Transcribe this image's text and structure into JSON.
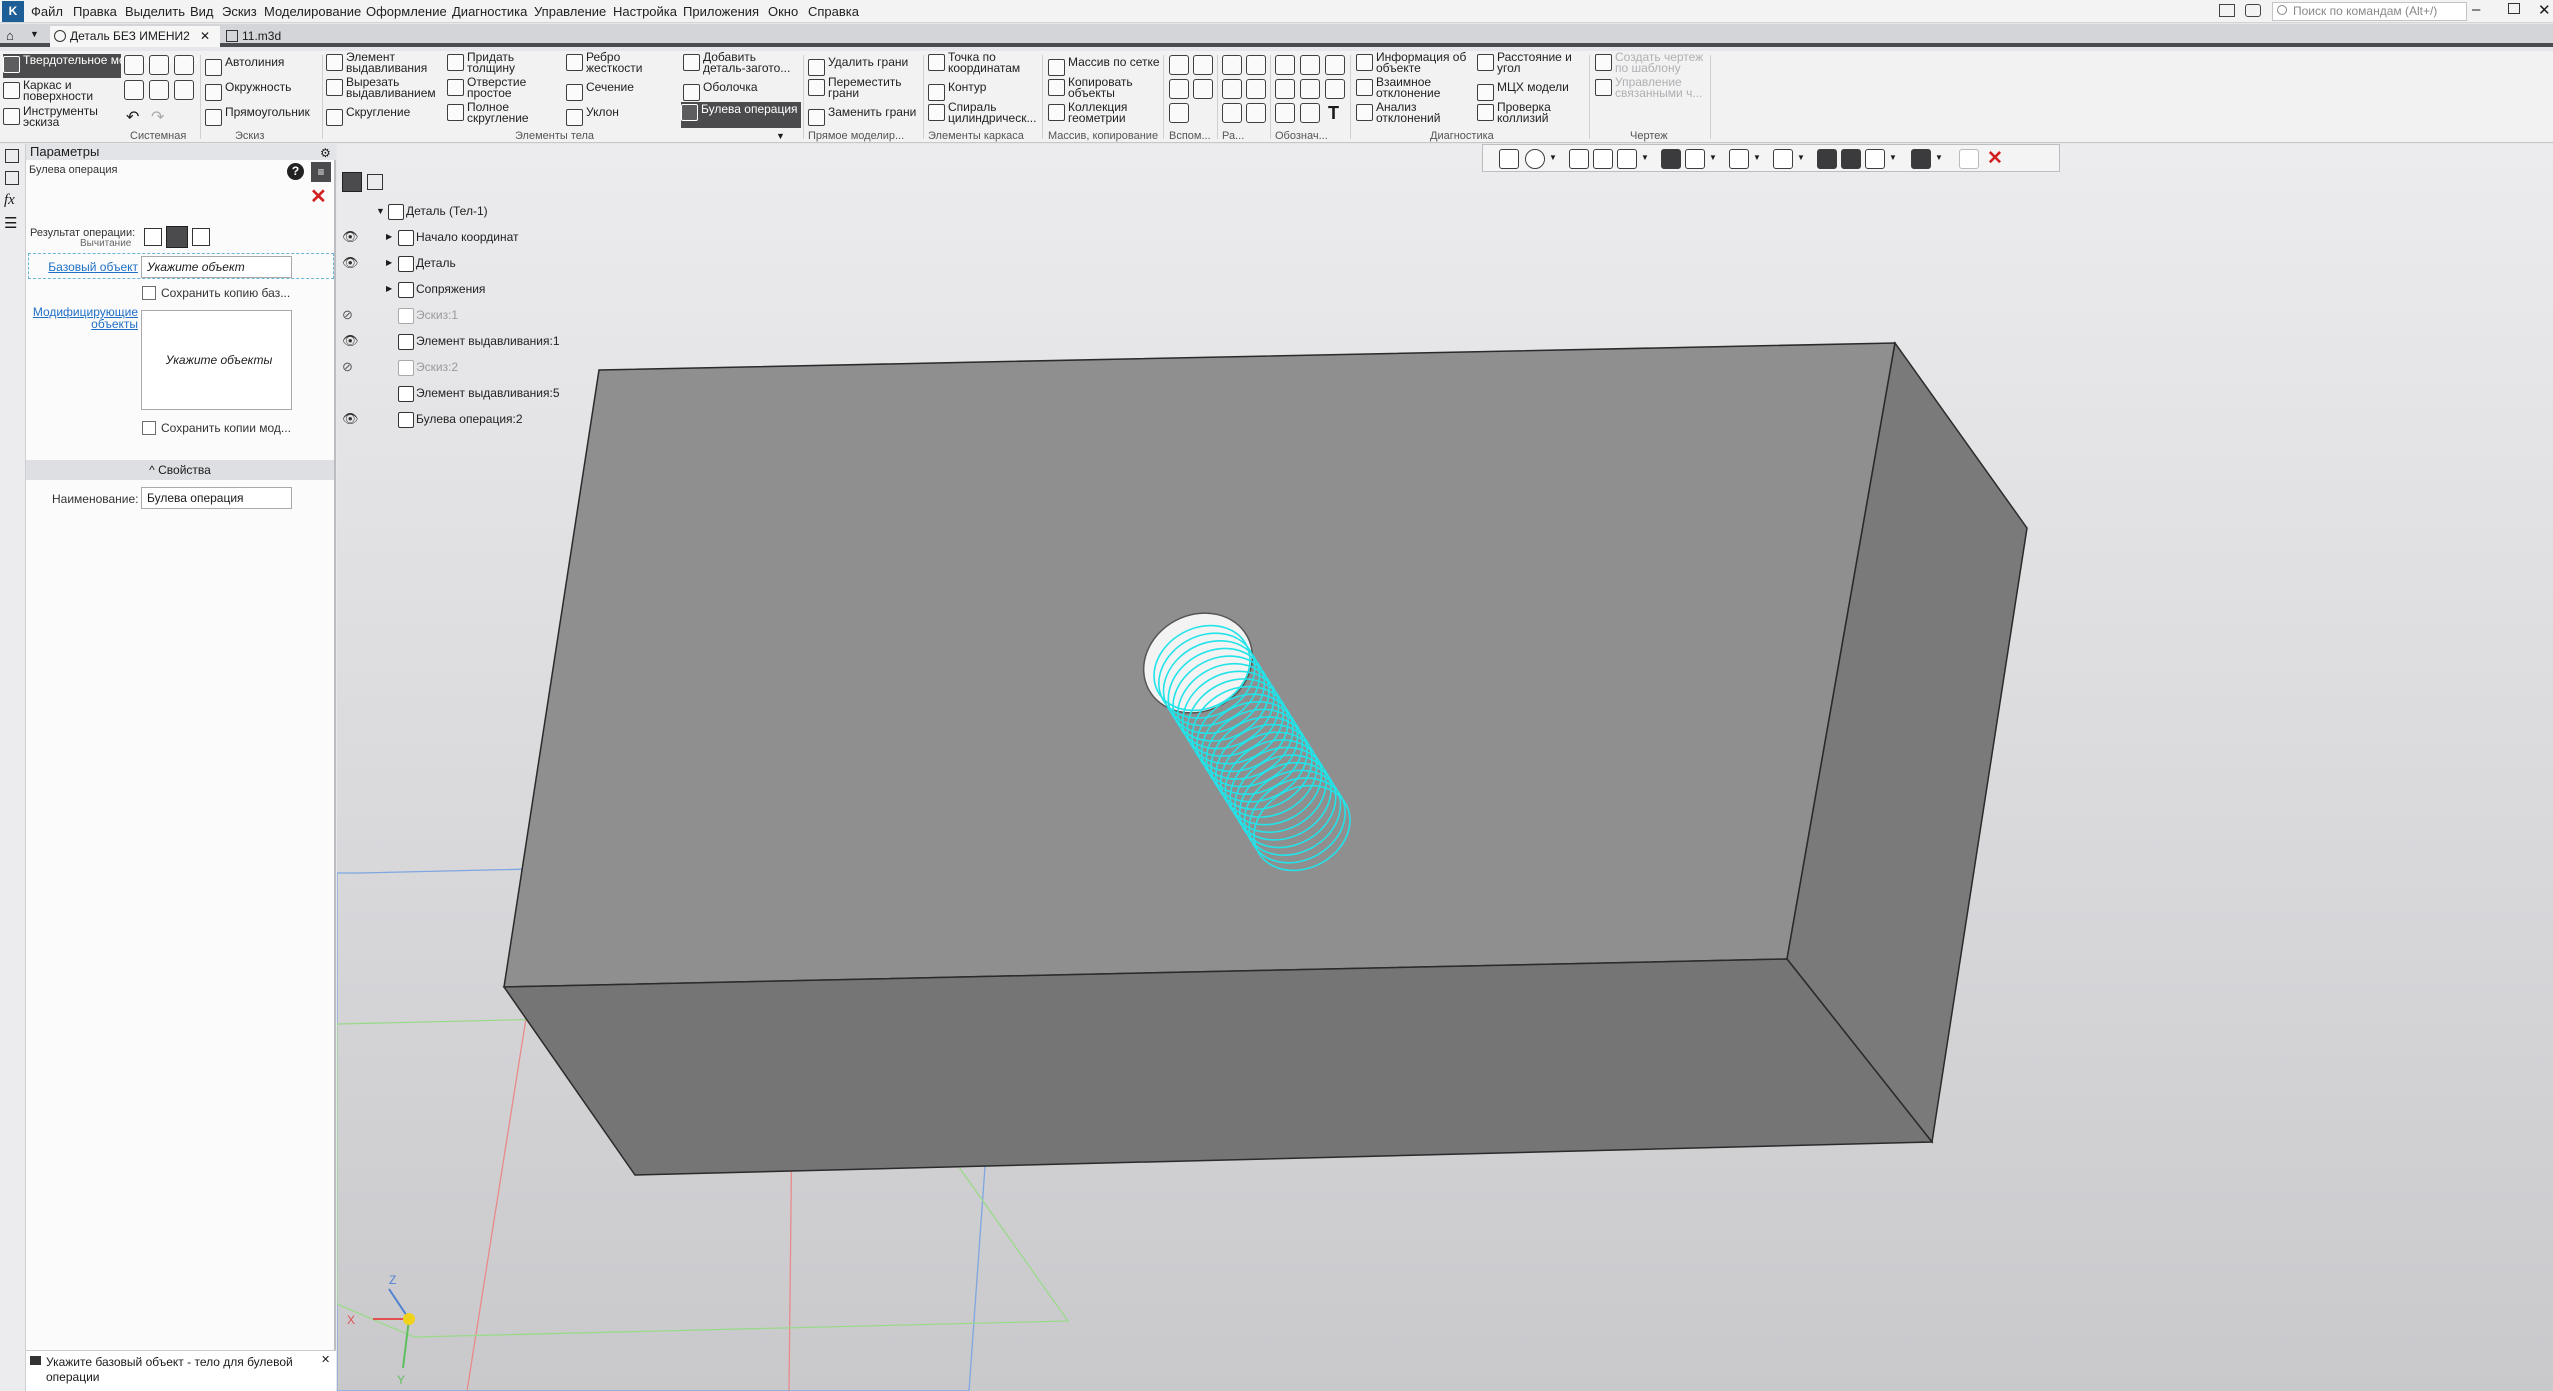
{
  "menu": [
    "Файл",
    "Правка",
    "Выделить",
    "Вид",
    "Эскиз",
    "Моделирование",
    "Оформление",
    "Диагностика",
    "Управление",
    "Настройка",
    "Приложения",
    "Окно",
    "Справка"
  ],
  "search": {
    "placeholder": "Поиск по командам (Alt+/)"
  },
  "tabs": [
    {
      "label": "Деталь БЕЗ ИМЕНИ2"
    },
    {
      "label": "11.m3d"
    }
  ],
  "ribbon": {
    "modes": [
      "Твердотельное моделирование",
      "Каркас и поверхности",
      "Инструменты эскиза"
    ],
    "sketch": [
      "Автолиния",
      "Окружность",
      "Прямоугольник"
    ],
    "body1": [
      "Элемент выдавливания",
      "Вырезать выдавливанием",
      "Скругление"
    ],
    "body2": [
      "Придать толщину",
      "Отверстие простое",
      "Полное скругление"
    ],
    "body3": [
      "Ребро жесткости",
      "Сечение",
      "Уклон"
    ],
    "body4": [
      "Добавить деталь-загото...",
      "Оболочка",
      "Булева операция"
    ],
    "direct": [
      "Удалить грани",
      "Переместить грани",
      "Заменить грани"
    ],
    "frame": [
      "Точка по координатам",
      "Контур",
      "Спираль цилиндрическ..."
    ],
    "arrays": [
      "Массив по сетке",
      "Копировать объекты",
      "Коллекция геометрии"
    ],
    "diag1": [
      "Информация об объекте",
      "Взаимное отклонение",
      "Анализ отклонений"
    ],
    "diag2": [
      "Расстояние и угол",
      "МЦХ модели",
      "Проверка коллизий"
    ],
    "drawing": [
      "Создать чертеж по шаблону",
      "Управление связанными ч..."
    ],
    "sections": [
      "Системная",
      "Эскиз",
      "Элементы тела",
      "Прямое моделир...",
      "Элементы каркаса",
      "Массив, копирование",
      "Вспом...",
      "Ра...",
      "Обознач...",
      "Диагностика",
      "Чертеж"
    ]
  },
  "params": {
    "header": "Параметры",
    "title": "Булева операция",
    "result_label": "Результат операции:",
    "result_value": "Вычитание",
    "base_label": "Базовый объект",
    "base_value": "Укажите объект",
    "keep_base": "Сохранить копию баз...",
    "modifying_label": "Модифицирующие объекты",
    "modifying_value": "Укажите объекты",
    "keep_mod": "Сохранить копии мод...",
    "properties": "Свойства",
    "name_label": "Наименование:",
    "name_value": "Булева операция"
  },
  "tree": [
    {
      "label": "Деталь (Тел-1)",
      "dim": false
    },
    {
      "label": "Начало координат",
      "dim": false
    },
    {
      "label": "Деталь",
      "dim": false
    },
    {
      "label": "Сопряжения",
      "dim": false
    },
    {
      "label": "Эскиз:1",
      "dim": true
    },
    {
      "label": "Элемент выдавливания:1",
      "dim": false
    },
    {
      "label": "Эскиз:2",
      "dim": true
    },
    {
      "label": "Элемент выдавливания:5",
      "dim": false
    },
    {
      "label": "Булева операция:2",
      "dim": false
    }
  ],
  "status": "Укажите базовый объект - тело для булевой операции",
  "axes": {
    "x": "X",
    "y": "Y",
    "z": "Z"
  },
  "colors": {
    "accent": "#1d5e96",
    "spring": "#22e3e8",
    "plane_red": "#e88a8a",
    "plane_green": "#9bd98a",
    "plane_blue": "#7fa6e0"
  }
}
